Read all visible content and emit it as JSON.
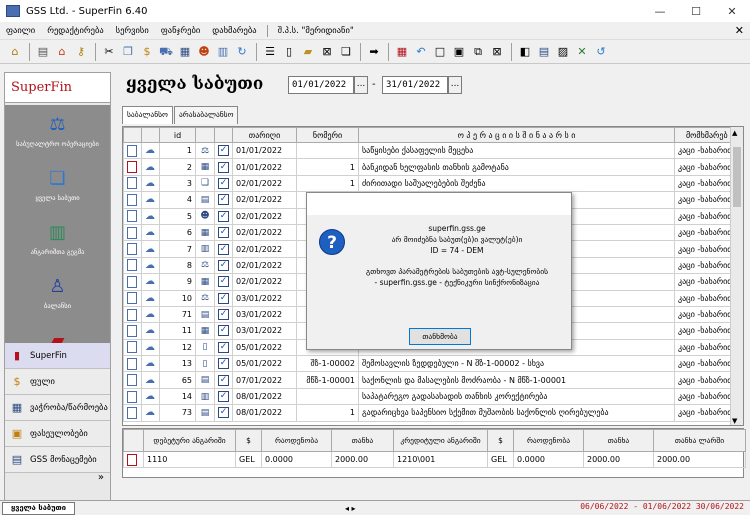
{
  "window": {
    "title": "GSS Ltd. - SuperFin 6.40",
    "minimize": "—",
    "maximize": "☐",
    "close": "✕"
  },
  "menu": {
    "items": [
      "ფაილი",
      "რედაქტირება",
      "სერვისი",
      "ფანჯრები",
      "დახმარება"
    ],
    "user": "შ.პ.ს. \"მერიდიანი\"",
    "close": "✕"
  },
  "toolbar": {
    "icons": [
      "home-icon",
      "printer-icon",
      "house-icon",
      "key-icon",
      "scissors-icon",
      "copy-icon",
      "money-icon",
      "car-icon",
      "calculator-icon",
      "person-icon",
      "cards-icon",
      "recycle-icon",
      "list-icon",
      "document-icon",
      "folder-icon",
      "close-doc-icon",
      "copy2-icon",
      "arrow-right-icon",
      "calendar-icon",
      "undo-icon",
      "square-icon",
      "window-icon",
      "export-icon",
      "close-square-icon",
      "back-icon",
      "save-icon",
      "image-icon",
      "tools-icon",
      "refresh-icon"
    ]
  },
  "sidebar": {
    "logo": "SuperFin",
    "icon_items": [
      {
        "label": "საბუღალტრო ოპერაციები",
        "icon": "scales-icon"
      },
      {
        "label": "ყველა საბუთი",
        "icon": "documents-icon"
      },
      {
        "label": "ანგარიშთა გეგმა",
        "icon": "book-icon"
      },
      {
        "label": "ბალანსი",
        "icon": "balance-icon"
      },
      {
        "label": "",
        "icon": "box-icon"
      }
    ],
    "nav": [
      {
        "label": "SuperFin",
        "icon": "superfin-icon",
        "active": true
      },
      {
        "label": "ფული",
        "icon": "money-icon",
        "active": false
      },
      {
        "label": "ვაჭრობა/წარმოება",
        "icon": "trade-icon",
        "active": false
      },
      {
        "label": "ფასეულობები",
        "icon": "valuables-icon",
        "active": false
      },
      {
        "label": "GSS მონაცემები",
        "icon": "gss-data-icon",
        "active": false
      }
    ],
    "more": "»"
  },
  "main": {
    "title": "ყველა საბუთი",
    "date_from": "01/01/2022",
    "date_to": "31/01/2022",
    "date_btn": "...",
    "dash": "-",
    "tabs": [
      "საბალანსო",
      "არასაბალანსო"
    ]
  },
  "grid": {
    "headers": [
      "",
      "",
      "id",
      "",
      "",
      "თარიღი",
      "ნომერი",
      "ო პ ე რ ა ც ი ი ს   შ ი ნ ა ა რ ს ი",
      "მომხმარებ"
    ],
    "rows": [
      {
        "id": "1",
        "date": "01/01/2022",
        "number": "",
        "desc": "საწყისები ქასაფელის მეცეხა",
        "user": "კაცი -ხახარიძე",
        "red": false
      },
      {
        "id": "2",
        "date": "01/01/2022",
        "number": "1",
        "desc": "ბანკიდან ხელფასის თანხის გამოტანა",
        "user": "კაცი -ხახარიძე",
        "red": true
      },
      {
        "id": "3",
        "date": "02/01/2022",
        "number": "1",
        "desc": "ძირითადი საშუალებების შეძენა",
        "user": "კაცი -ხახარიძე",
        "red": false
      },
      {
        "id": "4",
        "date": "02/01/2022",
        "number": "",
        "desc": "",
        "user": "კაცი -ხახარიძე",
        "red": false
      },
      {
        "id": "5",
        "date": "02/01/2022",
        "number": "",
        "desc": "",
        "user": "კაცი -ხახარიძე",
        "red": false
      },
      {
        "id": "6",
        "date": "02/01/2022",
        "number": "",
        "desc": "",
        "user": "კაცი -ხახარიძე",
        "red": false
      },
      {
        "id": "7",
        "date": "02/01/2022",
        "number": "",
        "desc": "",
        "user": "კაცი -ხახარიძე",
        "red": false
      },
      {
        "id": "8",
        "date": "02/01/2022",
        "number": "",
        "desc": "ქნების",
        "user": "კაცი -ხახარიძე",
        "red": false
      },
      {
        "id": "9",
        "date": "02/01/2022",
        "number": "",
        "desc": "",
        "user": "კაცი -ხახარიძე",
        "red": false
      },
      {
        "id": "10",
        "date": "03/01/2022",
        "number": "",
        "desc": "ხადი საშუალებების",
        "user": "კაცი -ხახარიძე",
        "red": false
      },
      {
        "id": "71",
        "date": "03/01/2022",
        "number": "",
        "desc": "",
        "user": "კაცი -ხახარიძე",
        "red": false
      },
      {
        "id": "11",
        "date": "03/01/2022",
        "number": "",
        "desc": "",
        "user": "კაცი -ხახარიძე",
        "red": false
      },
      {
        "id": "12",
        "date": "05/01/2022",
        "number": "",
        "desc": "",
        "user": "კაცი -ხახარიძე",
        "red": false
      },
      {
        "id": "13",
        "date": "05/01/2022",
        "number": "შზ-1-00002",
        "desc": "შემოსავლის ზედდებული - N შზ-1-00002 - სხვა",
        "user": "კაცი -ხახარიძე",
        "red": false
      },
      {
        "id": "65",
        "date": "07/01/2022",
        "number": "მწზ-1-00001",
        "desc": "საქონლის და მასალების მოძრაობა - N მწზ-1-00001",
        "user": "კაცი -ხახარიძე",
        "red": false
      },
      {
        "id": "14",
        "date": "08/01/2022",
        "number": "",
        "desc": "საპატარეგო გადასახადის თანხის კორექტირება",
        "user": "კაცი -ხახარიძე",
        "red": false
      },
      {
        "id": "73",
        "date": "08/01/2022",
        "number": "1",
        "desc": "გადარიცხვა საპენსიო სქემით მუშაობის საქონლის ღირებულება",
        "user": "კაცი -ხახარიძე",
        "red": false
      }
    ]
  },
  "summary": {
    "headers": [
      "",
      "დებეტური ანგარიში",
      "$",
      "რაოდენობა",
      "თანხა",
      "კრედიტული ანგარიში",
      "$",
      "რაოდენობა",
      "თანხა",
      "თანხა ლარში"
    ],
    "row": [
      "",
      "1110",
      "GEL",
      "0.0000",
      "2000.00",
      "1210\\001",
      "GEL",
      "0.0000",
      "2000.00",
      "2000.00"
    ]
  },
  "status": {
    "tab": "ყველა საბუთი",
    "nav": "◂ ▸",
    "dates": "06/06/2022 - 01/06/2022 30/06/2022"
  },
  "dialog": {
    "line1": "superfin.gss.ge",
    "line2": "არ მოიძებნა საბუთ(ებ)ი ვალუტ(ებ)ი",
    "line3": "ID = 74 - DEM",
    "line4": "გთხოვთ პარამეტრების საბუთების ავტ-სულენობის",
    "line5": "- superfin.gss.ge - ტექნიკური სინქრონიზაცია",
    "ok": "თანხმობა",
    "icon": "?"
  },
  "colors": {
    "accent_red": "#b3121a",
    "brand_blue": "#1f5fbf",
    "sidebar_gray": "#8c8c8c"
  }
}
